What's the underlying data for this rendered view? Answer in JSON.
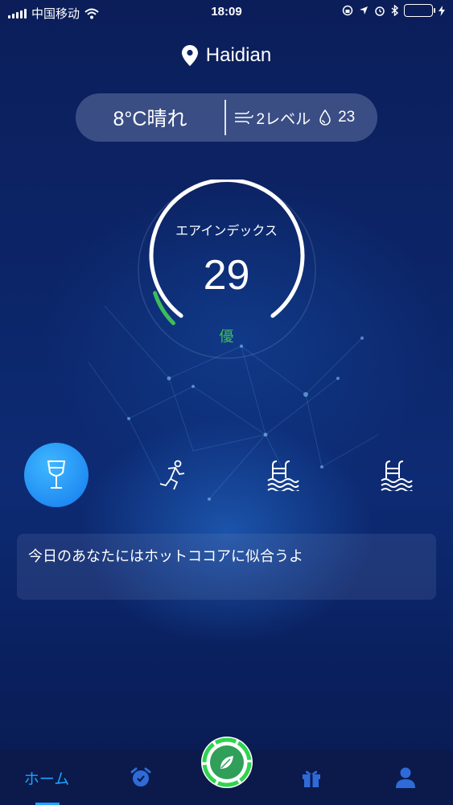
{
  "status_bar": {
    "carrier": "中国移动",
    "time": "18:09",
    "battery_level": 1.0,
    "icons": [
      "signal-icon",
      "wifi-icon",
      "screen-lock-icon",
      "location-arrow-icon",
      "alarm-icon",
      "bluetooth-icon",
      "battery-icon",
      "charging-icon"
    ]
  },
  "location": {
    "name": "Haidian",
    "icon": "location-pin-icon"
  },
  "weather": {
    "temp_condition": "8°C晴れ",
    "wind": "2レベル",
    "humidity": "23",
    "icons": [
      "wind-icon",
      "humidity-drop-icon"
    ]
  },
  "air": {
    "label": "エアインデックス",
    "value": "29",
    "level": "優",
    "progress_fraction": 0.1,
    "colors": {
      "ring": "#ffffff",
      "progress": "#3dbd5a",
      "level": "#3dbd5a"
    }
  },
  "activities": [
    {
      "name": "drink",
      "icon": "wine-glass-icon",
      "active": true
    },
    {
      "name": "run",
      "icon": "running-icon",
      "active": false
    },
    {
      "name": "swim",
      "icon": "swimming-pool-icon",
      "active": false
    },
    {
      "name": "swim-2",
      "icon": "swimming-pool-icon",
      "active": false
    }
  ],
  "message": "今日のあなたにはホットココアに似合うよ",
  "tabbar": {
    "home_label": "ホーム",
    "accent": "#1aa3ff",
    "icons": [
      "alarm-clock-icon",
      "leaf-icon",
      "gift-icon",
      "profile-icon"
    ]
  }
}
